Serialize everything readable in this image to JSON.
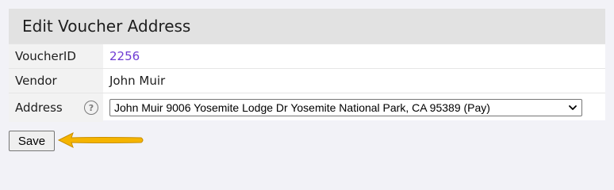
{
  "panel": {
    "title": "Edit Voucher Address"
  },
  "fields": {
    "voucher_id_label": "VoucherID",
    "voucher_id_value": "2256",
    "vendor_label": "Vendor",
    "vendor_value": "John Muir",
    "address_label": "Address",
    "address_help_glyph": "?",
    "address_selected": "John Muir 9006 Yosemite Lodge Dr Yosemite National Park, CA 95389 (Pay)"
  },
  "actions": {
    "save_label": "Save"
  },
  "colors": {
    "page_background": "#f2f2f7",
    "header_background": "#e2e2e2",
    "label_cell_background": "#f2f2f2",
    "link_value": "#6f3cd3",
    "annotation_arrow": "#f5b400"
  },
  "icons": {
    "help": "question-circle-icon",
    "dropdown": "chevron-down-icon",
    "annotation": "arrow-left-icon"
  }
}
